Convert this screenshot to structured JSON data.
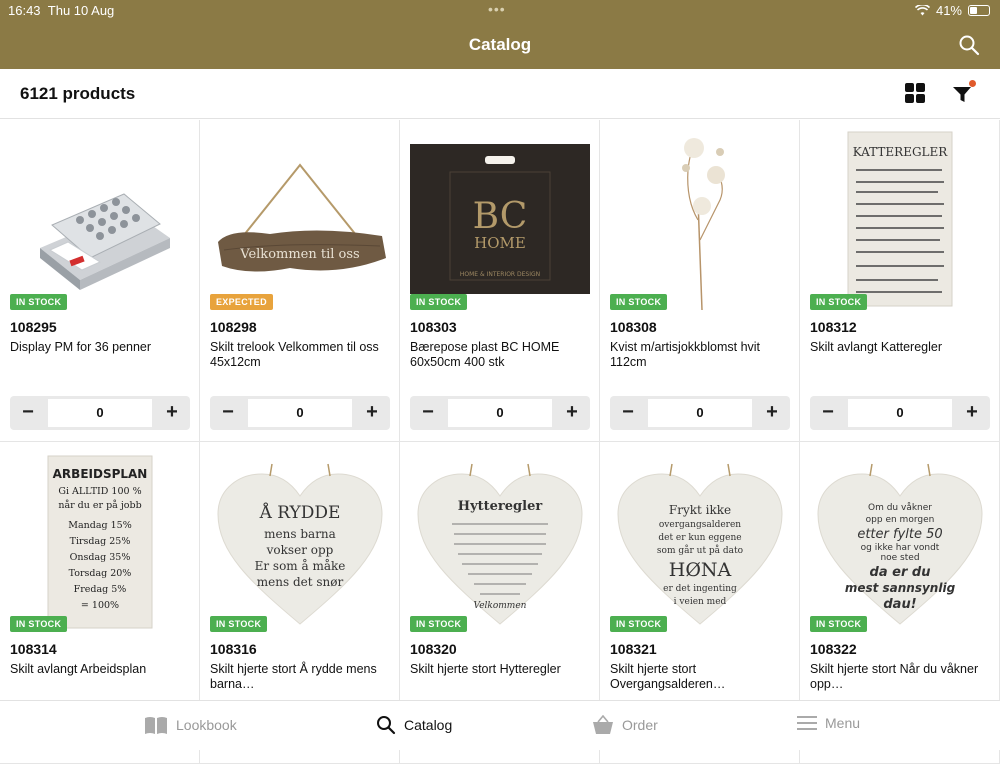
{
  "status": {
    "time": "16:43",
    "date": "Thu 10 Aug",
    "battery": "41%",
    "battery_level": 0.41
  },
  "nav": {
    "title": "Catalog"
  },
  "toolbar": {
    "count_label": "6121 products"
  },
  "products": [
    {
      "sku": "108295",
      "name": "Display PM for 36 penner",
      "stock": "IN STOCK",
      "qty": "0"
    },
    {
      "sku": "108298",
      "name": "Skilt trelook Velkommen til oss 45x12cm",
      "stock": "EXPECTED",
      "qty": "0"
    },
    {
      "sku": "108303",
      "name": "Bærepose plast BC HOME 60x50cm 400 stk",
      "stock": "IN STOCK",
      "qty": "0"
    },
    {
      "sku": "108308",
      "name": "Kvist m/artisjokkblomst hvit 112cm",
      "stock": "IN STOCK",
      "qty": "0"
    },
    {
      "sku": "108312",
      "name": "Skilt avlangt Katteregler",
      "stock": "IN STOCK",
      "qty": "0"
    },
    {
      "sku": "108314",
      "name": "Skilt avlangt Arbeidsplan",
      "stock": "IN STOCK",
      "qty": ""
    },
    {
      "sku": "108316",
      "name": "Skilt hjerte stort Å rydde mens barna…",
      "stock": "IN STOCK",
      "qty": ""
    },
    {
      "sku": "108320",
      "name": "Skilt hjerte stort Hytteregler",
      "stock": "IN STOCK",
      "qty": ""
    },
    {
      "sku": "108321",
      "name": "Skilt hjerte stort Overgangsalderen…",
      "stock": "IN STOCK",
      "qty": ""
    },
    {
      "sku": "108322",
      "name": "Skilt hjerte stort Når du våkner opp…",
      "stock": "IN STOCK",
      "qty": ""
    }
  ],
  "stepper": {
    "minus": "−",
    "plus": "+"
  },
  "artwork": {
    "sign_velkommen": "Velkommen til oss",
    "bag_logo_top": "BC",
    "bag_logo_bottom": "HOME",
    "bag_tagline": "HOME & INTERIOR DESIGN",
    "katteregler_title": "KATTEREGLER",
    "arbeidsplan_title": "ARBEIDSPLAN",
    "arbeidsplan_lines": [
      "Gi ALLTID 100 %",
      "når du er på jobb",
      "Mandag  15%",
      "Tirsdag  25%",
      "Onsdag  35%",
      "Torsdag  20%",
      "Fredag  5%",
      "=  100%"
    ],
    "rydde_lines": [
      "Å RYDDE",
      "mens barna",
      "vokser opp",
      "Er som å måke",
      "mens det snør"
    ],
    "hytte_title": "Hytteregler",
    "hytte_footer": "Velkommen",
    "hona_lines": [
      "Frykt ikke",
      "overgangsalderen",
      "det er kun eggene",
      "som går ut på dato",
      "HØNA",
      "er det ingenting",
      "i veien med"
    ],
    "vakner_lines": [
      "Om du våkner",
      "opp en morgen",
      "etter fylte 50",
      "og ikke har vondt",
      "noe sted",
      "da er du",
      "mest sannsynlig",
      "dau!"
    ]
  },
  "tabs": [
    {
      "label": "Lookbook",
      "icon": "book-icon",
      "active": false
    },
    {
      "label": "Catalog",
      "icon": "search-icon",
      "active": true
    },
    {
      "label": "Order",
      "icon": "basket-icon",
      "active": false
    },
    {
      "label": "Menu",
      "icon": "menu-icon",
      "active": false
    }
  ],
  "colors": {
    "brand": "#8b7a45",
    "in_stock": "#4caf50",
    "expected": "#e8a33c",
    "filter_dot": "#e05a2b"
  }
}
